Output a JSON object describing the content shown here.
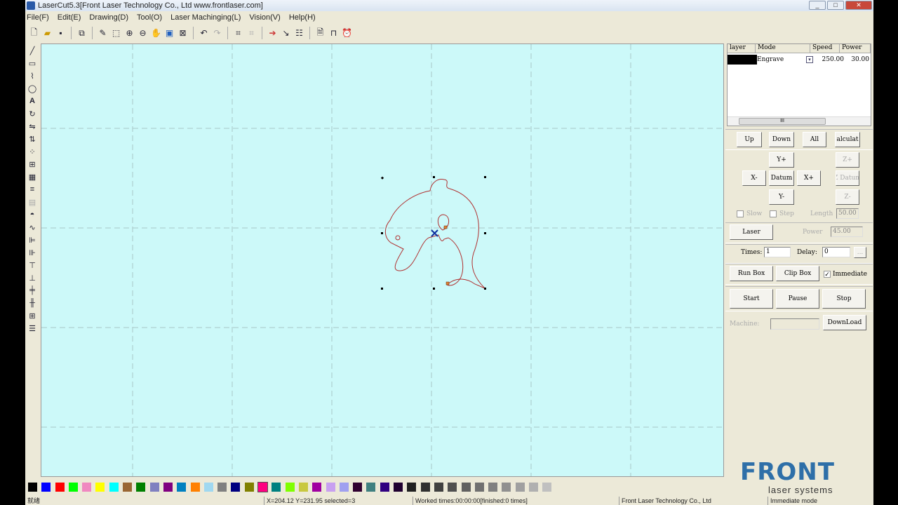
{
  "window": {
    "title": "LaserCut5.3[Front Laser Technology Co., Ltd www.frontlaser.com]"
  },
  "menu": [
    "File(F)",
    "Edit(E)",
    "Drawing(D)",
    "Tool(O)",
    "Laser Machinging(L)",
    "Vision(V)",
    "Help(H)"
  ],
  "toolbar": [
    "new-file",
    "open",
    "save",
    "import",
    "brush",
    "select",
    "zoom-in",
    "zoom-out",
    "pan",
    "zoom-page",
    "zoom-fit",
    "undo",
    "redo",
    "group",
    "ungroup",
    "cut-order",
    "direction",
    "array",
    "preview",
    "machine",
    "clock"
  ],
  "left_toolbar": [
    "line",
    "rectangle",
    "polyline",
    "ellipse",
    "text",
    "rotate",
    "mirror-h",
    "mirror-v",
    "nodes",
    "array",
    "grid",
    "align-lines",
    "hatch",
    "fill",
    "curve",
    "align-left",
    "align-right",
    "align-top",
    "align-bottom",
    "center-h",
    "center-v",
    "center",
    "layers"
  ],
  "layers": {
    "headers": [
      "layer",
      "Mode",
      "Speed",
      "Power"
    ],
    "rows": [
      {
        "color": "#000000",
        "mode": "Engrave",
        "speed": "250.00",
        "power": "30.00"
      }
    ],
    "scroll_thumb": "III"
  },
  "panel": {
    "up": "Up",
    "down": "Down",
    "all": "All",
    "calculate": "alculat",
    "yplus": "Y+",
    "yminus": "Y-",
    "xminus": "X-",
    "xplus": "X+",
    "datum": "Datum",
    "zplus": "Z+",
    "zdatum": "Z Datum",
    "zminus": "Z-",
    "slow": "Slow",
    "step": "Step",
    "length_label": "Length",
    "length": "50.00",
    "laser": "Laser",
    "power_label": "Power",
    "power": "45.00",
    "times_label": "Times:",
    "times": "1",
    "delay_label": "Delay:",
    "delay": "0",
    "more": "...",
    "run_box": "Run Box",
    "clip_box": "Clip Box",
    "immediate": "Immediate",
    "immediate_checked": true,
    "start": "Start",
    "pause": "Pause",
    "stop": "Stop",
    "machine_label": "Machine:",
    "machine": "",
    "download": "DownLoad"
  },
  "palette": [
    "#000000",
    "#0000ff",
    "#ff0000",
    "#00ff00",
    "#f088c0",
    "#ffff00",
    "#00ffff",
    "#996633",
    "#008000",
    "#8080c0",
    "#800080",
    "#0080c0",
    "#ff8000",
    "#a0d8f0",
    "#808080",
    "#000080",
    "#808000",
    "#ff0080",
    "#008080",
    "#80ff00",
    "#c8c840",
    "#a000a0",
    "#c8a0f0",
    "#a0a0f0",
    "#300030",
    "#408080",
    "#300080",
    "#200030",
    "#202020",
    "#303030",
    "#404040",
    "#505050",
    "#606060",
    "#707070",
    "#808080",
    "#909090",
    "#a0a0a0",
    "#b0b0b0",
    "#c0c0c0"
  ],
  "logo": {
    "brand": "FRONT",
    "tagline": "laser systems"
  },
  "status": {
    "ready": "就绪",
    "coords": "X=204.12 Y=231.95 selected=3",
    "worked": "Worked times:00:00:00[finished:0 times]",
    "company": "Front Laser Technology Co., Ltd",
    "mode": "Immediate mode"
  },
  "colors": {
    "canvas": "#ccf9f9",
    "shape": "#b03030",
    "grid": "#a8c8c8"
  }
}
